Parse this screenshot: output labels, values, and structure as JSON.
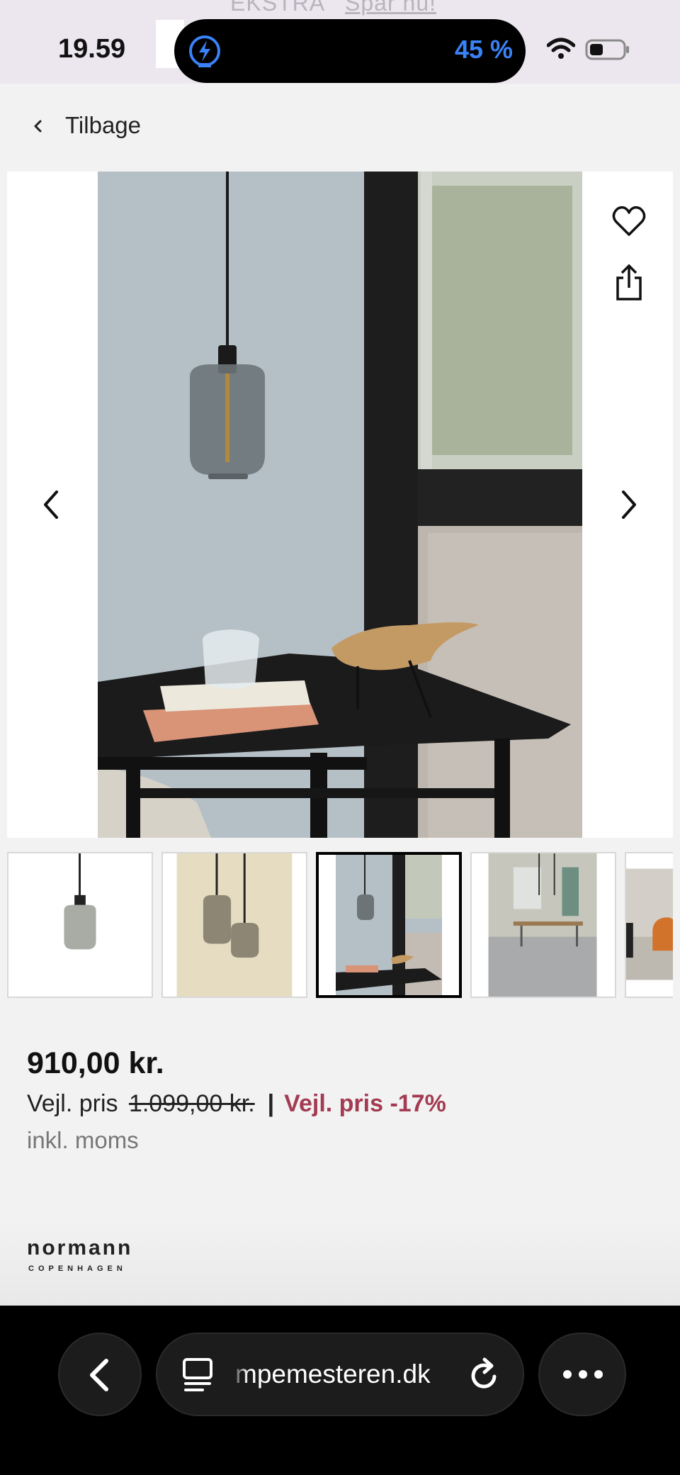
{
  "status_bar": {
    "time": "19.59",
    "battery_percent": "45 %",
    "promo_text": "EKSTRA",
    "promo_link": "Spar nu!"
  },
  "nav": {
    "back_label": "Tilbage"
  },
  "product": {
    "price": "910,00 kr.",
    "rrp_label": "Vejl. pris",
    "rrp_old": "1.099,00 kr.",
    "separator": "|",
    "discount": "Vejl. pris -17%",
    "vat_note": "inkl. moms",
    "brand_name": "normann",
    "brand_sub": "COPENHAGEN"
  },
  "gallery": {
    "active_thumbnail_index": 2,
    "thumbnail_count": 5
  },
  "browser": {
    "url": "mpemesteren.dk"
  },
  "colors": {
    "discount": "#a33b52",
    "battery_text": "#3a82f7",
    "page_bg": "#f2f2f2"
  }
}
